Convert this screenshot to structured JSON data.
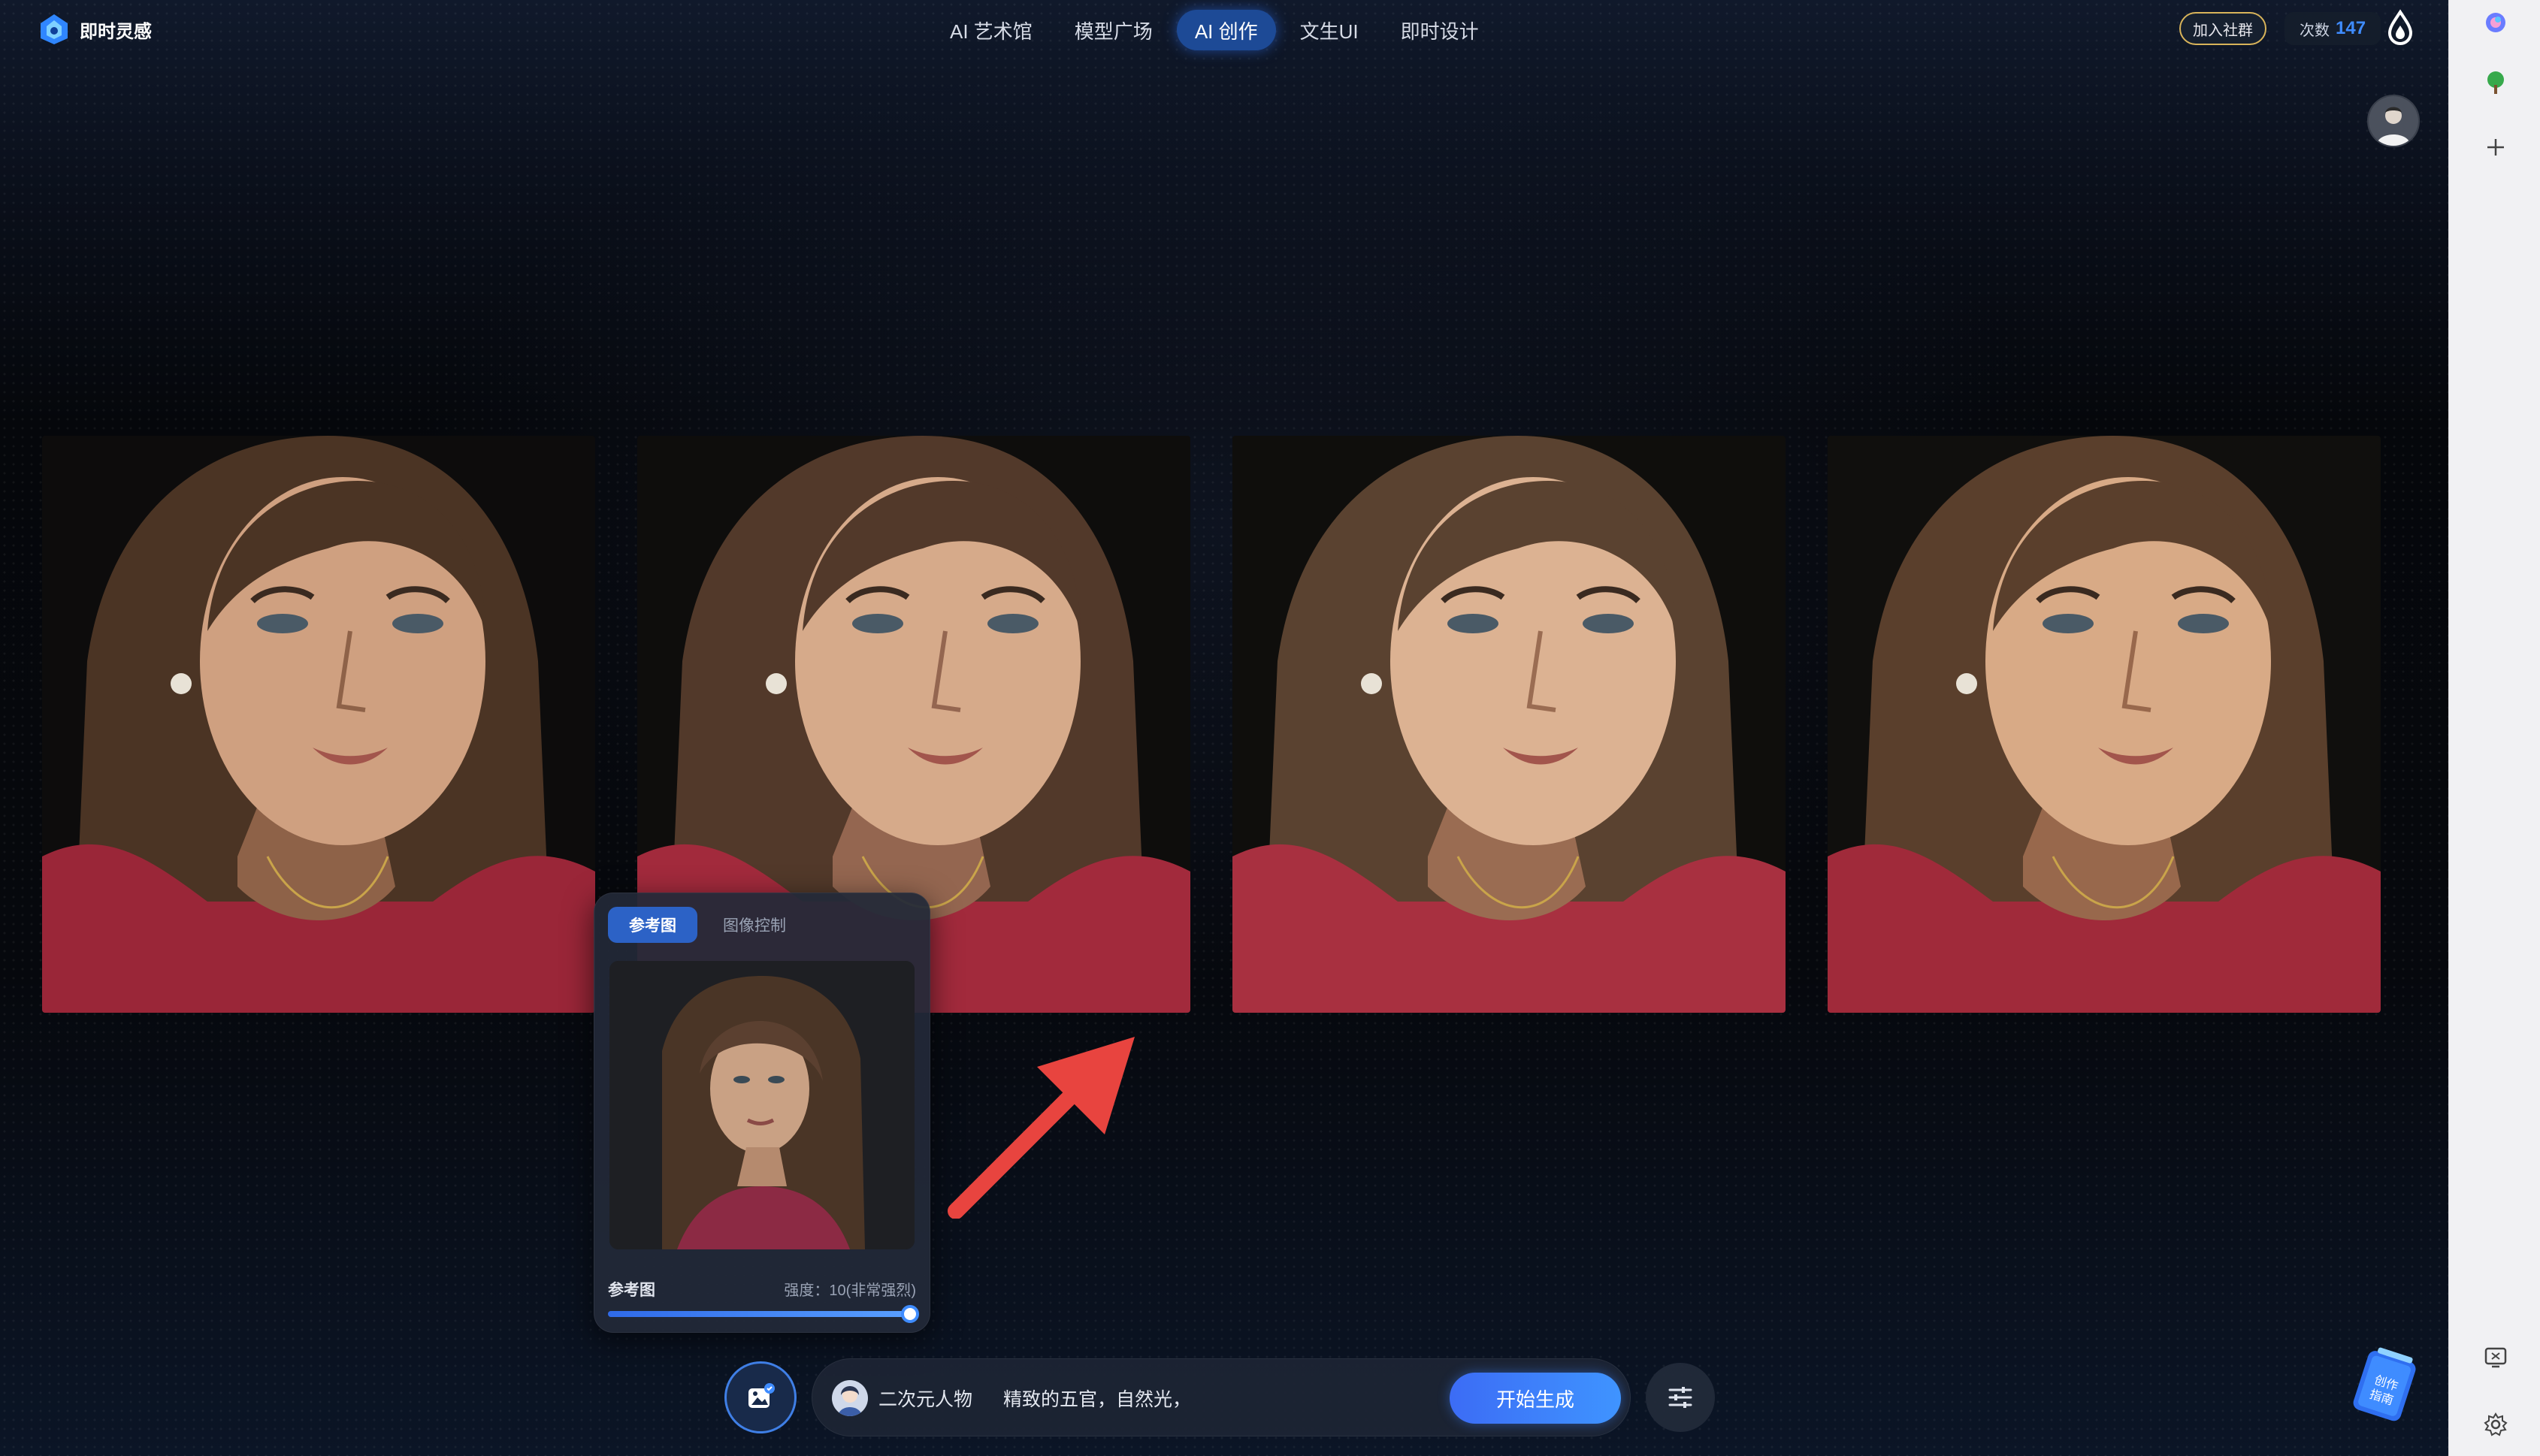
{
  "app": {
    "name": "即时灵感"
  },
  "nav": {
    "tabs": [
      {
        "label": "AI 艺术馆",
        "active": false
      },
      {
        "label": "模型广场",
        "active": false
      },
      {
        "label": "AI 创作",
        "active": true
      },
      {
        "label": "文生UI",
        "active": false
      },
      {
        "label": "即时设计",
        "active": false
      }
    ]
  },
  "header": {
    "join_label": "加入社群",
    "credits_label": "次数",
    "credits_value": "147"
  },
  "gallery": {
    "count": 4
  },
  "reference_panel": {
    "tabs": [
      "参考图",
      "图像控制"
    ],
    "active_tab": 0,
    "label": "参考图",
    "strength_text": "强度：10(非常强烈)",
    "strength_fraction": 1.0
  },
  "prompt_bar": {
    "style_name": "二次元人物",
    "prompt_text": "精致的五官，自然光，",
    "generate_label": "开始生成"
  },
  "guide": {
    "label": "创作指南"
  },
  "colors": {
    "accent": "#3f8cff",
    "active_tab_bg": "#1d4a96",
    "arrow": "#e8443f",
    "join_border": "#d9b45a"
  },
  "icons": [
    "logo-icon",
    "droplet-icon",
    "user-avatar",
    "image-upload-icon",
    "sliders-icon",
    "guide-book-icon",
    "copilot-icon",
    "tree-icon",
    "plus-icon",
    "screenshot-icon",
    "gear-icon"
  ]
}
